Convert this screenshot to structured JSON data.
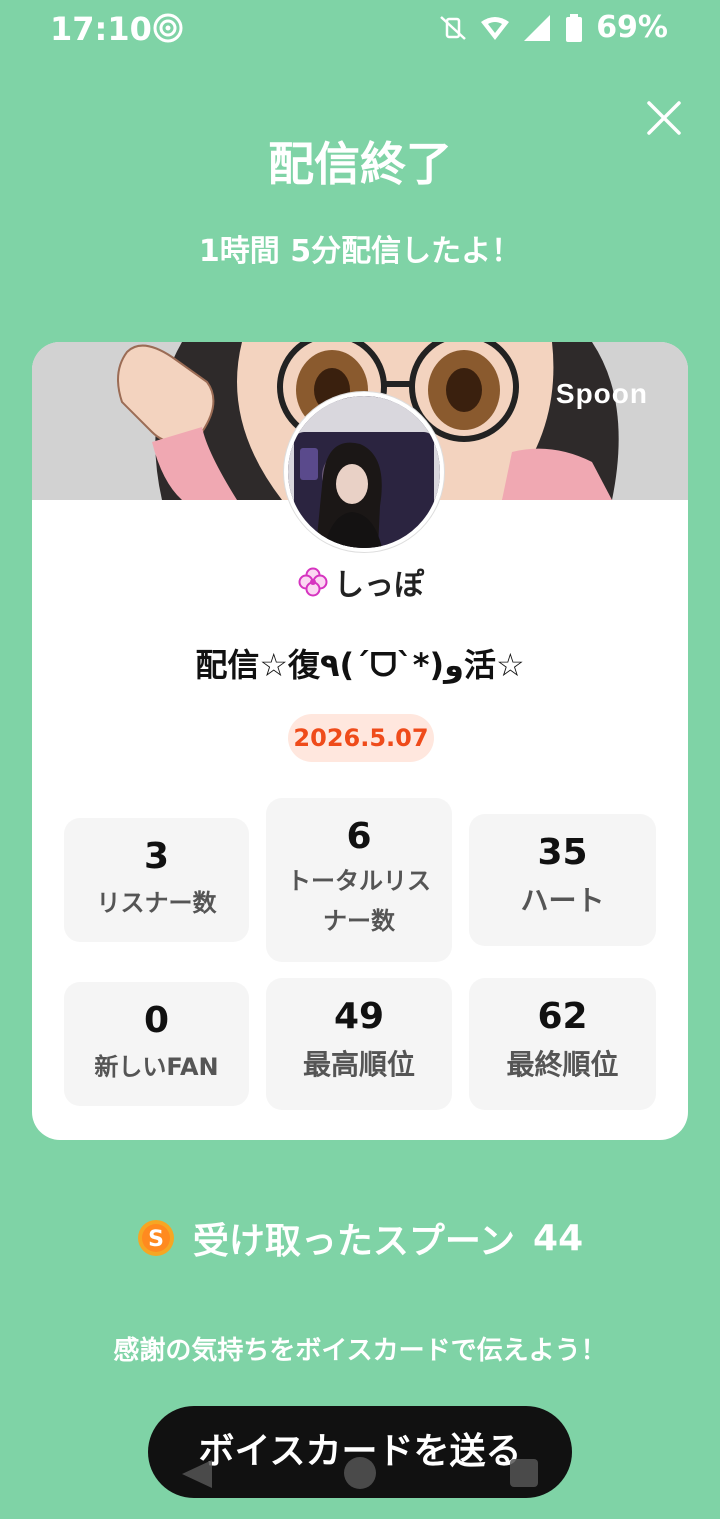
{
  "status_bar": {
    "time": "17:10",
    "battery": "69%",
    "icons": [
      "hotspot-icon",
      "mute-vibrate-icon",
      "wifi-icon",
      "signal-icon",
      "battery-icon"
    ]
  },
  "header": {
    "title": "配信終了",
    "subtitle": "1時間 5分配信したよ！"
  },
  "card": {
    "brand": "Spoon",
    "username": "しっぽ",
    "broadcast_title": "配信☆復٩(ˊᗜˋ*)و活☆",
    "date": "2026.5.07",
    "stats": [
      {
        "value": "3",
        "label": "リスナー数"
      },
      {
        "value": "6",
        "label": "トータルリスナー数"
      },
      {
        "value": "35",
        "label": "ハート"
      },
      {
        "value": "0",
        "label": "新しいFAN"
      },
      {
        "value": "49",
        "label": "最高順位"
      },
      {
        "value": "62",
        "label": "最終順位"
      }
    ]
  },
  "spoons": {
    "label": "受け取ったスプーン",
    "count": "44"
  },
  "footer": {
    "thanks": "感謝の気持ちをボイスカードで伝えよう！",
    "send_button": "ボイスカードを送る"
  },
  "colors": {
    "background": "#7fd3a6",
    "date_badge_bg": "#ffe7de",
    "date_badge_text": "#ef4b1a",
    "button_bg": "#111111"
  }
}
